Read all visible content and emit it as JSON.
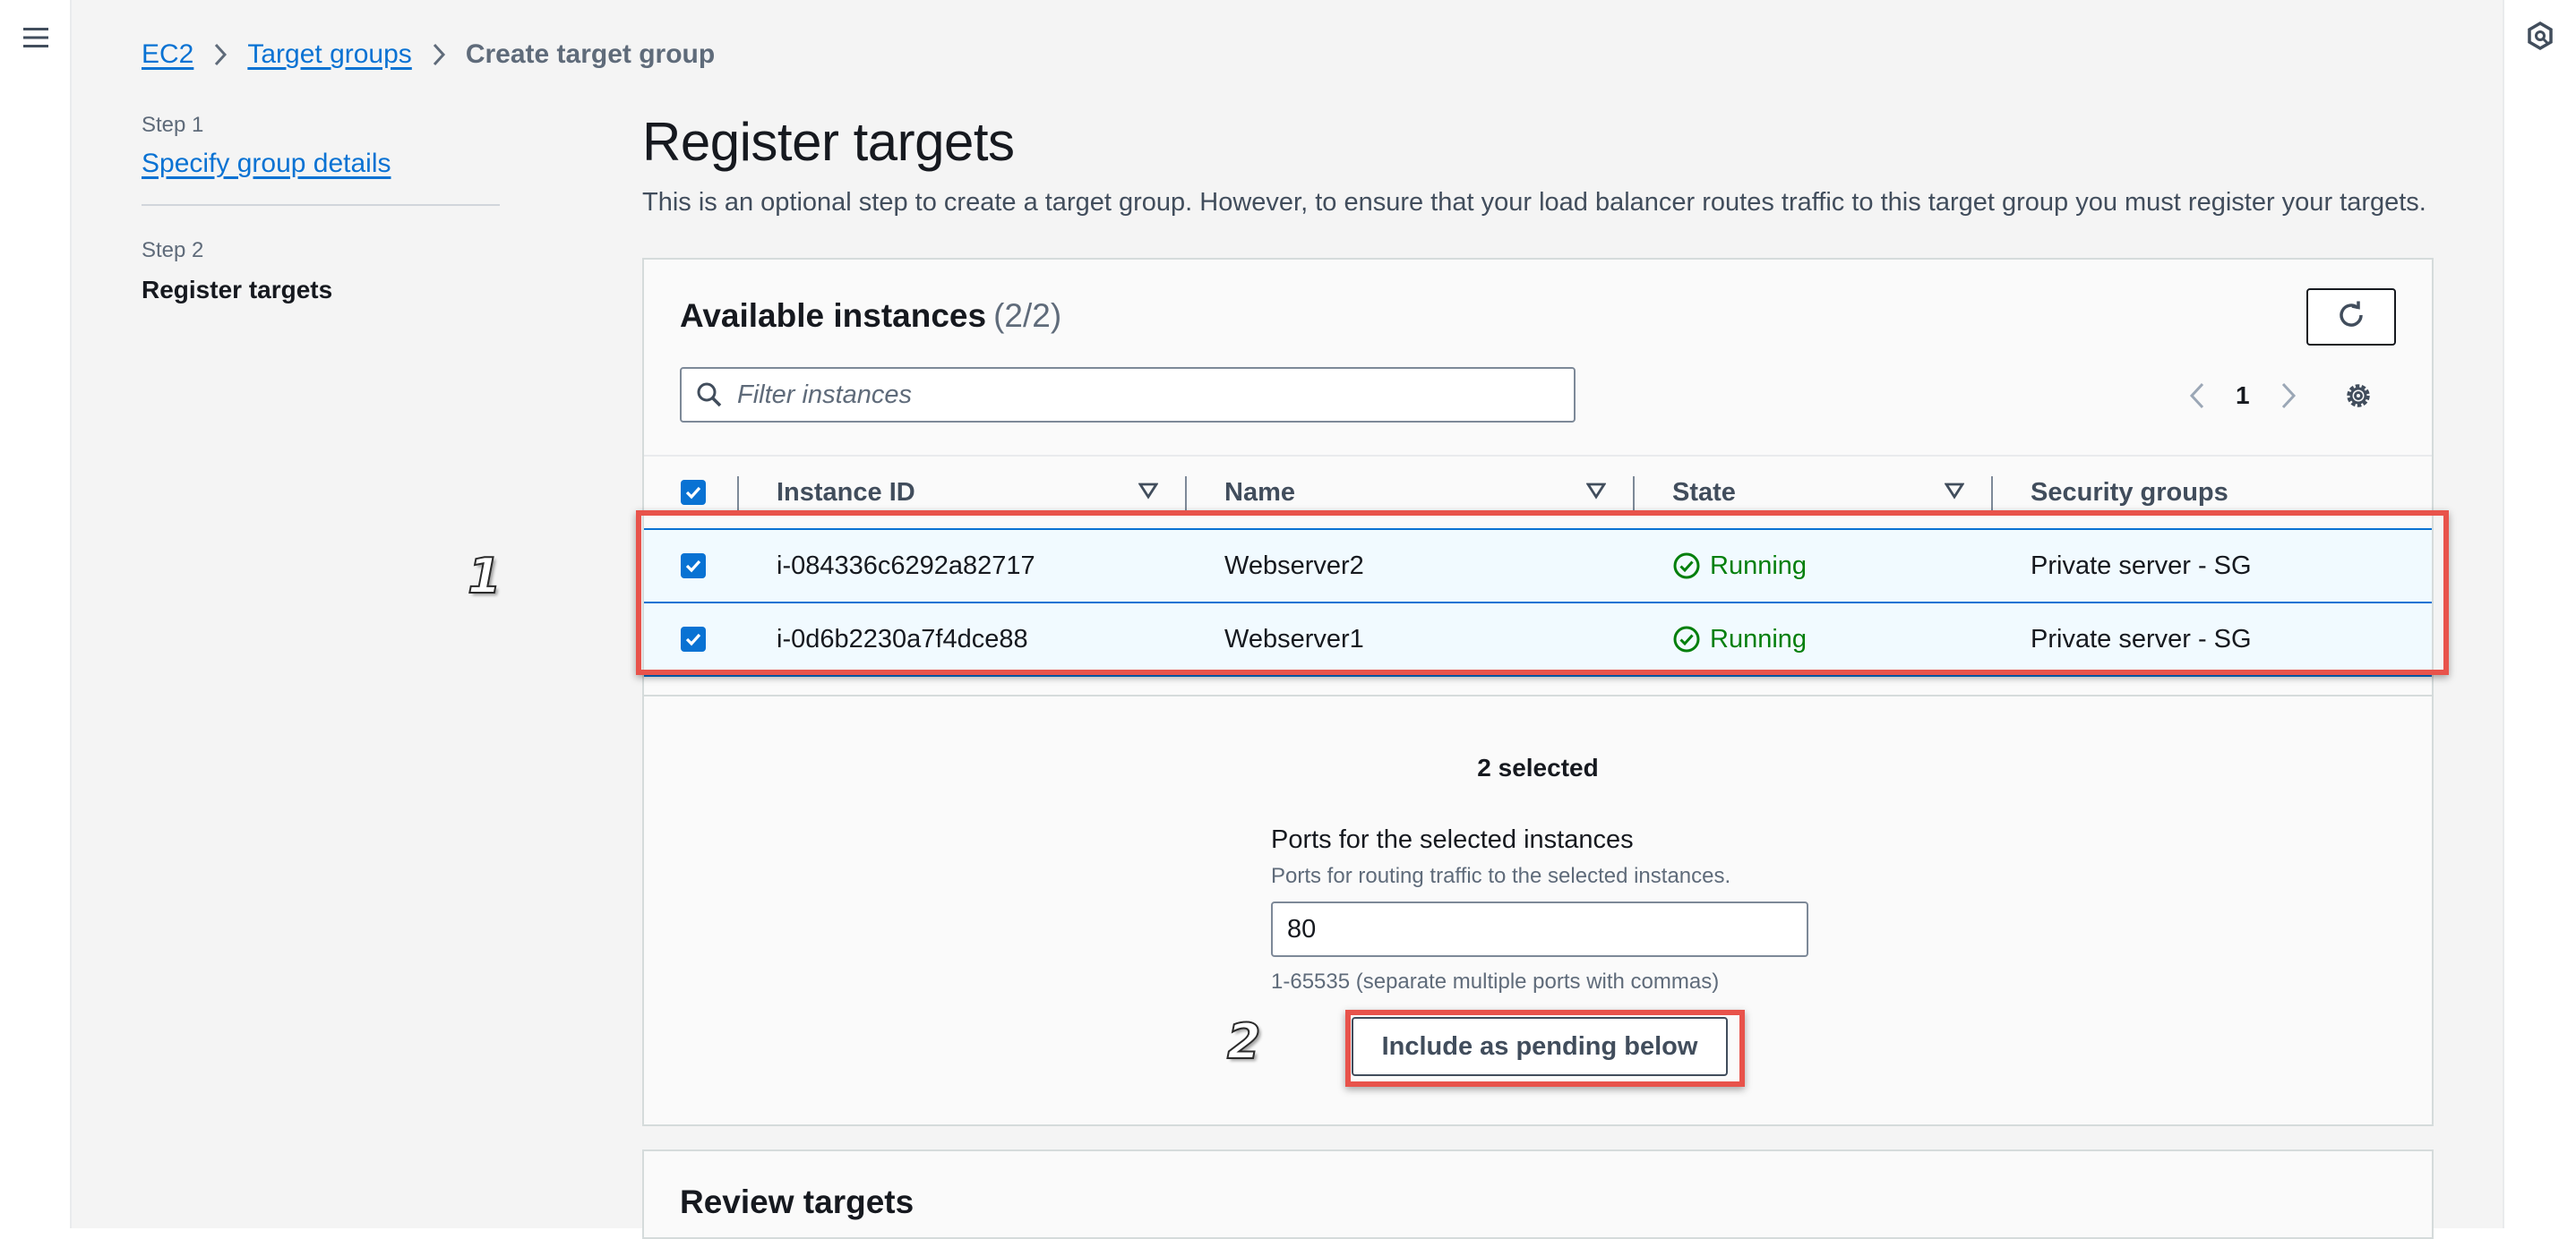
{
  "breadcrumb": {
    "items": [
      "EC2",
      "Target groups"
    ],
    "current": "Create target group"
  },
  "steps": [
    {
      "caption": "Step 1",
      "label": "Specify group details"
    },
    {
      "caption": "Step 2",
      "label": "Register targets"
    }
  ],
  "page": {
    "title": "Register targets",
    "description": "This is an optional step to create a target group. However, to ensure that your load balancer routes traffic to this target group you must register your targets."
  },
  "available": {
    "title": "Available instances",
    "count": "(2/2)",
    "filter_placeholder": "Filter instances",
    "page_number": "1",
    "columns": [
      "Instance ID",
      "Name",
      "State",
      "Security groups"
    ],
    "rows": [
      {
        "instance_id": "i-084336c6292a82717",
        "name": "Webserver2",
        "state": "Running",
        "security_group": "Private server - SG"
      },
      {
        "instance_id": "i-0d6b2230a7f4dce88",
        "name": "Webserver1",
        "state": "Running",
        "security_group": "Private server - SG"
      }
    ],
    "selected_count": "2 selected"
  },
  "ports": {
    "label": "Ports for the selected instances",
    "description": "Ports for routing traffic to the selected instances.",
    "value": "80",
    "hint": "1-65535 (separate multiple ports with commas)"
  },
  "include_button": "Include as pending below",
  "review": {
    "title": "Review targets"
  },
  "callouts": [
    "1",
    "2"
  ],
  "colors": {
    "link": "#0972d3",
    "running": "#037f0c",
    "highlight": "#e8534b",
    "selected_row": "#f1faff"
  },
  "icons": [
    "menu-icon",
    "chevron-right-icon",
    "refresh-icon",
    "search-icon",
    "chevron-left-icon",
    "settings-icon",
    "sort-down-icon",
    "check-circle-icon",
    "checkbox-checked-icon",
    "info-panel-icon"
  ]
}
